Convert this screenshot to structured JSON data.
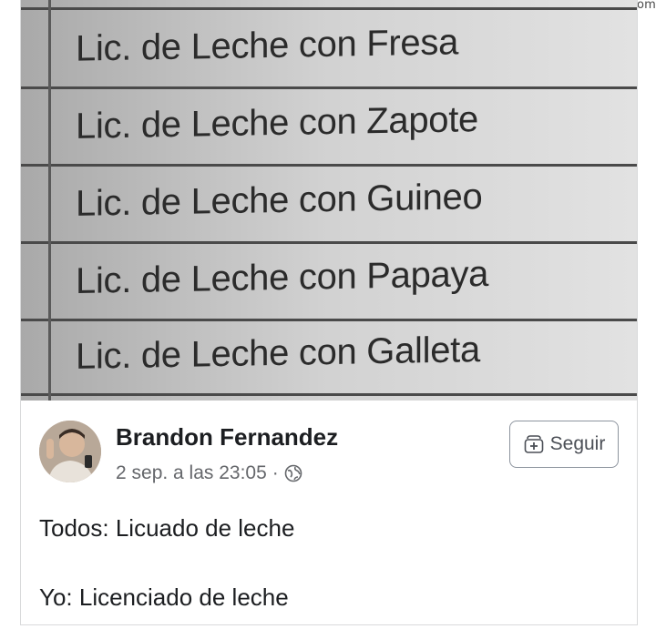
{
  "watermark": "notadictionary.com",
  "photo": {
    "rows": [
      "Lic. de Leche con Fresa",
      "Lic. de Leche con Zapote",
      "Lic. de Leche con Guineo",
      "Lic. de Leche con Papaya",
      "Lic. de Leche con Galleta"
    ]
  },
  "post": {
    "author": "Brandon Fernandez",
    "timestamp": "2 sep. a las 23:05",
    "separator": "·",
    "audience_icon": "globe-icon",
    "follow_label": "Seguir",
    "follow_icon": "add-follow-icon",
    "line1": "Todos: Licuado de leche",
    "line2": "Yo: Licenciado de leche"
  },
  "colors": {
    "author_text": "#1c1e21",
    "meta_text": "#65676b",
    "button_border": "#8d949e"
  }
}
